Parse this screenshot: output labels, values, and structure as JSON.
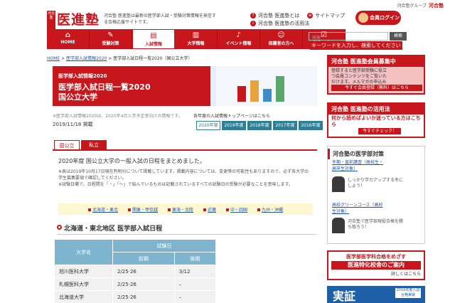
{
  "header": {
    "group_label": "河合塾グループ",
    "group_brand": "河合塾",
    "logo_small": "河合塾",
    "logo_text": "医進塾",
    "tagline": "河合塾 医進塾は最新の医学部入試・受験対策情報を発信する合格応援サイトです。",
    "link_about": "河合塾 医進塾とは",
    "link_sitemap": "サイトマップ",
    "link_usage": "河合塾 医進塾の活用法",
    "login_label": "会員ログイン"
  },
  "nav": {
    "items": [
      {
        "label": "HOME",
        "glyph": "⌂"
      },
      {
        "label": "受験対策",
        "glyph": "✎"
      },
      {
        "label": "入試情報",
        "glyph": "▤"
      },
      {
        "label": "大学情報",
        "glyph": "▥"
      },
      {
        "label": "イベント情報",
        "glyph": "♪"
      },
      {
        "label": "保護者の方へ",
        "glyph": "☺"
      },
      {
        "label": "塾生の方へ",
        "glyph": "☑"
      }
    ],
    "search_placeholder": "検索",
    "search_button": "検索",
    "search_hint": "キーワードを入力し、検索してください"
  },
  "breadcrumb": {
    "home": "HOME",
    "sep": ">",
    "level1": "医学部入試情報2020",
    "current": "医学部入試日程一覧2020（国公立大学）"
  },
  "hero": {
    "kicker": "医学部入試情報2020",
    "title": "医学部入試日程一覧2020",
    "subtitle": "国公立大学"
  },
  "meta": {
    "note": "※医学部入試情報2020は、2020年4月入学予定者向けの情報です。",
    "date": "2019/11/18 掲載",
    "years_link": "各年度の入試情報トップページはこちら",
    "years": [
      "2020年度",
      "2019年度",
      "2018年度",
      "2017年度",
      "2016年度"
    ]
  },
  "tabs": {
    "public": "国公立",
    "private": "私立"
  },
  "content": {
    "intro": "2020年度 国公立大学の一般入試の日程をまとめました。",
    "note1": "※表は2019年10月17日現在判明分について掲載しています。掲載内容については、変更等の可能性もありますので、必ず各大学の学生募集要項で確認してください。",
    "note2": "※試験日欄で、日程間を「・」「～」で結んでいるものは記載されているすべての試験日の受験が必要なことを意味します。",
    "regions": [
      "北海道・東北",
      "関東・甲信越",
      "東海・北陸",
      "近畿",
      "中・四国",
      "九州・沖縄"
    ],
    "section_title": "北海道・東北地区 医学部入試日程"
  },
  "table": {
    "col_university": "大学名",
    "col_exam_date": "試験日",
    "col_early": "前期",
    "col_late": "後期",
    "rows": [
      {
        "name": "旭川医科大学",
        "early": "2/25·26",
        "late": "3/12"
      },
      {
        "name": "札幌医科大学",
        "early": "2/25·26",
        "late": "–"
      },
      {
        "name": "北海道大学",
        "early": "2/25·26",
        "late": "–"
      }
    ]
  },
  "sidebar": {
    "ad1_title": "河合塾 医進塾会員募集中",
    "ad1_body": "登録すると医学部受験に役立つ会員コンテンツをご覧いただけます。メルマガの申込みもこちらから。",
    "ad1_cta": "今すぐ会員登録（無料）はこちら",
    "ad2_title": "河合塾 医進塾の活用法",
    "ad2_body": "何から読めばよいか迷っている方はこちら",
    "ad2_cta": "今すぐチェック！",
    "box_title": "河合塾の医学部対策",
    "item1": "冬期・直前講習（高校生・高卒生対象）",
    "item1_desc": "しっかり学力アップする冬にしよう！",
    "item2": "高校グリーンコース（高校生対象）",
    "item2_desc": "河合塾で医学部現役合格を勝ち取ろう！",
    "ad3_top": "医学部医学科合格をめざす",
    "ad3_main": "医進特化校舎のご案内",
    "ad3_link": "詳しくはこちら",
    "ad4_big": "実証",
    "ad4_small": "2019年度入試合格実績"
  },
  "colors": {
    "brand_red": "#c8161d",
    "teal": "#2e7e96",
    "table_header": "#7fb4cf",
    "link_blue": "#1a55a8"
  }
}
